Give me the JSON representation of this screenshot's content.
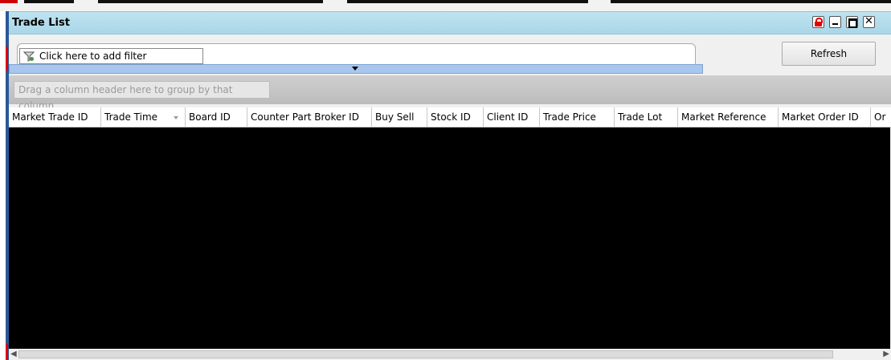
{
  "window": {
    "title": "Trade List"
  },
  "toolbar": {
    "filter_label": "Click here to add filter",
    "refresh_label": "Refresh"
  },
  "grid": {
    "group_hint": "Drag a column header here to group by that column.",
    "columns": [
      "Market Trade ID",
      "Trade Time",
      "Board ID",
      "Counter Part Broker ID",
      "Buy Sell",
      "Stock ID",
      "Client ID",
      "Trade Price",
      "Trade Lot",
      "Market Reference",
      "Market Order ID",
      "Or"
    ],
    "rows": []
  },
  "icons": {
    "lock": "lock-icon",
    "minimize": "minimize-icon",
    "maximize": "maximize-icon",
    "close": "close-icon",
    "filter": "filter-icon",
    "collapse": "chevron-down-icon"
  },
  "colors": {
    "titlebar": "#a9d7e8",
    "grid_body": "#000000",
    "accent_red": "#e00000"
  }
}
